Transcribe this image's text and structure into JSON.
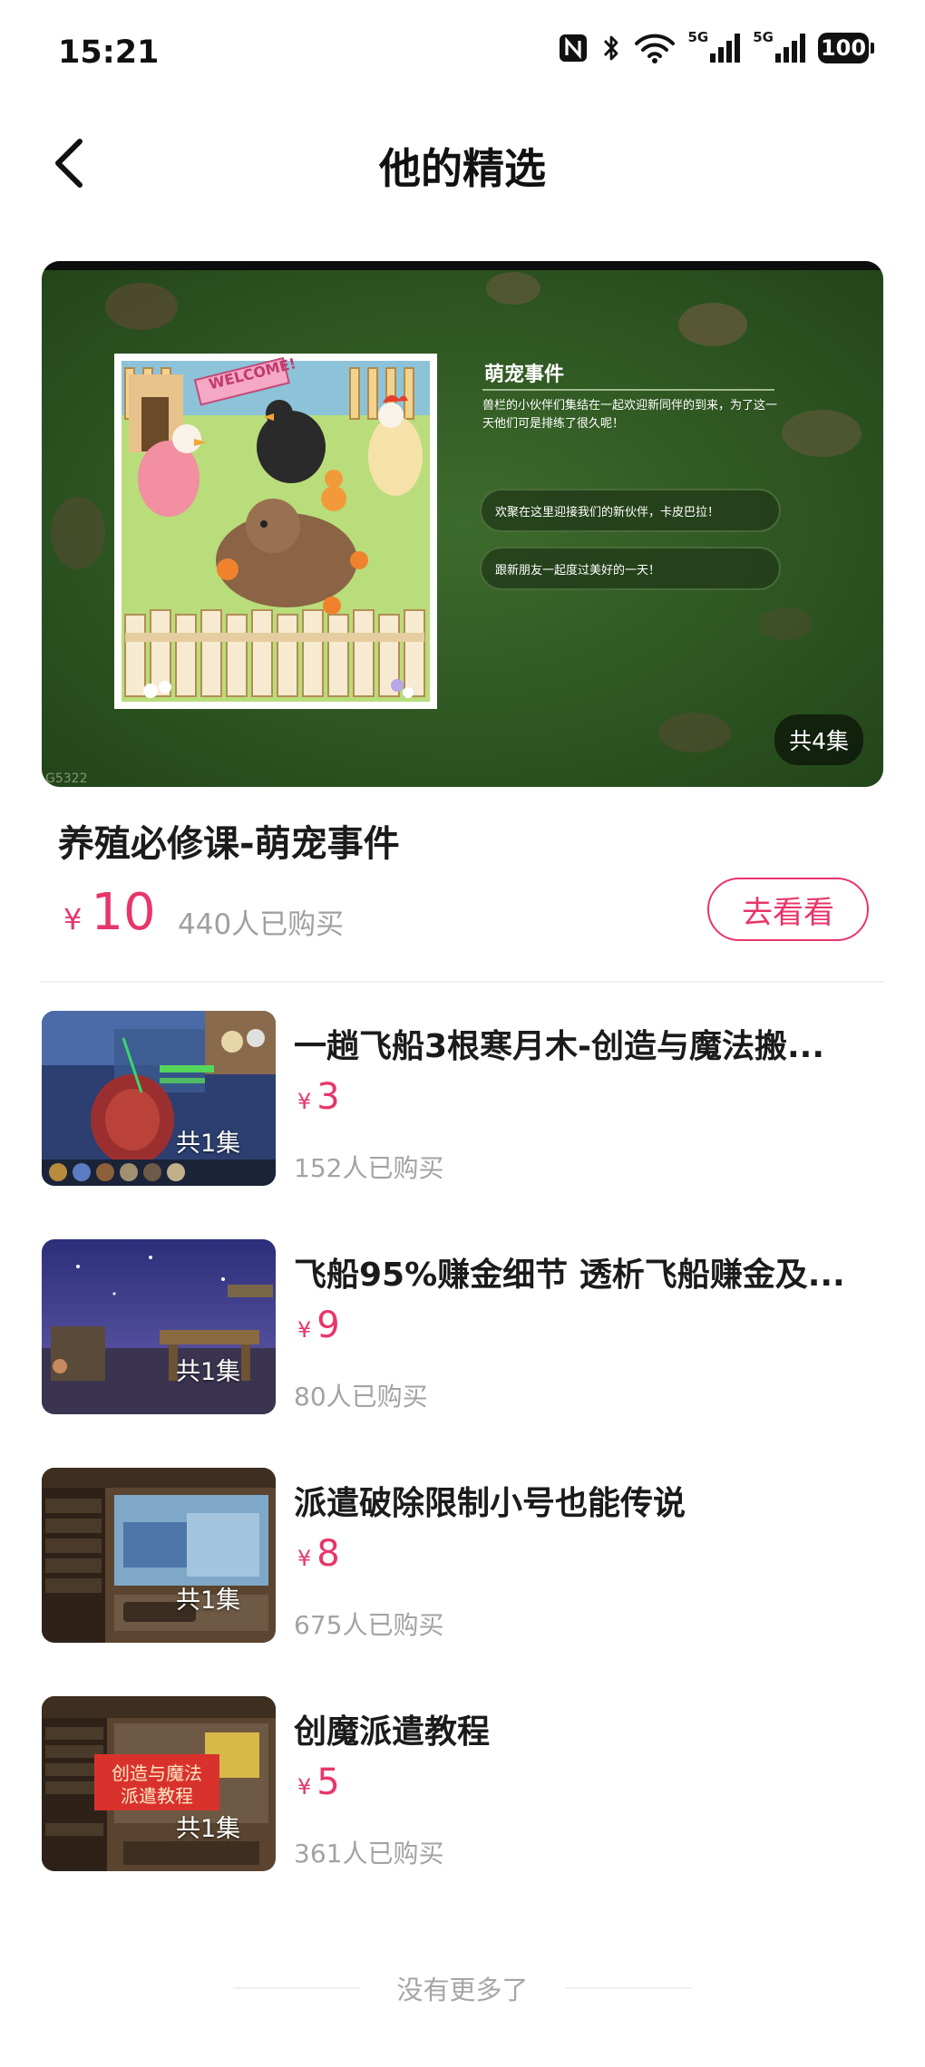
{
  "status": {
    "time": "15:21",
    "net1": "5G",
    "net2": "5G",
    "battery": "100"
  },
  "header": {
    "title": "他的精选"
  },
  "featured": {
    "title": "养殖必修课-萌宠事件",
    "currency": "¥",
    "price": "10",
    "sold": "440人已购买",
    "episodes": "共4集",
    "cta": "去看看",
    "cover": {
      "panel_title": "萌宠事件",
      "panel_desc": "兽栏的小伙伴们集结在一起欢迎新同伴的到来，为了这一天他们可是排练了很久呢！",
      "option1": "欢聚在这里迎接我们的新伙伴，卡皮巴拉！",
      "option2": "跟新朋友一起度过美好的一天！",
      "sign": "WELCOME!",
      "watermark": "G5322"
    }
  },
  "items": [
    {
      "title": "一趟飞船3根寒月木-创造与魔法搬...",
      "currency": "¥",
      "price": "3",
      "sold": "152人已购买",
      "episodes": "共1集"
    },
    {
      "title": "飞船95%赚金细节 透析飞船赚金及...",
      "currency": "¥",
      "price": "9",
      "sold": "80人已购买",
      "episodes": "共1集"
    },
    {
      "title": "派遣破除限制小号也能传说",
      "currency": "¥",
      "price": "8",
      "sold": "675人已购买",
      "episodes": "共1集"
    },
    {
      "title": "创魔派遣教程",
      "currency": "¥",
      "price": "5",
      "sold": "361人已购买",
      "episodes": "共1集",
      "banner_line1": "创造与魔法",
      "banner_line2": "派遣教程"
    }
  ],
  "footer": {
    "text": "没有更多了"
  },
  "colors": {
    "accent": "#e8356a",
    "muted": "#a3a3a3"
  }
}
